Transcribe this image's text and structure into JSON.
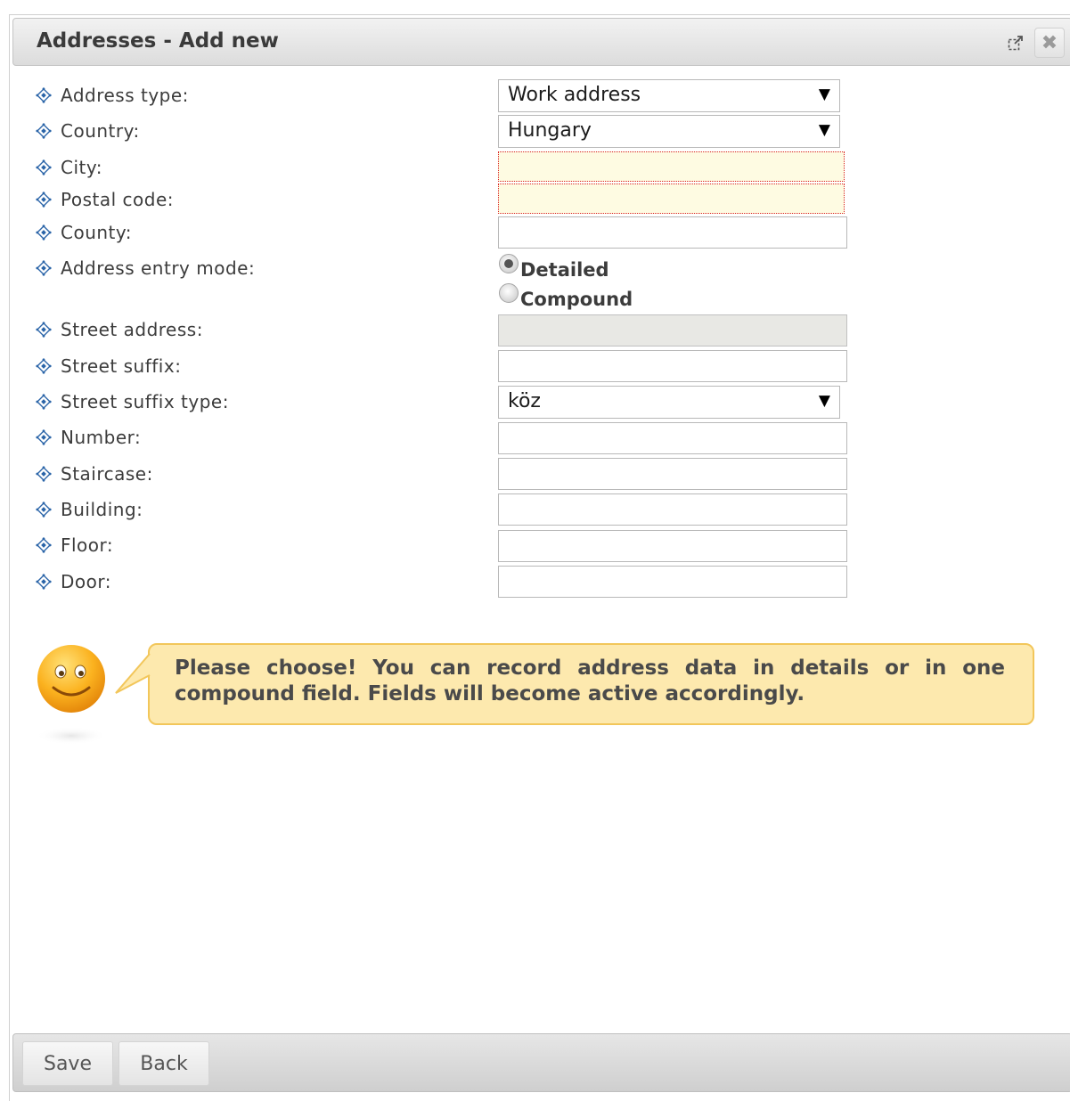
{
  "window": {
    "title": "Addresses - Add new",
    "popout_icon": "popout-icon",
    "close_icon": "close-icon"
  },
  "form": {
    "labels": {
      "address_type": "Address type:",
      "country": "Country:",
      "city": "City:",
      "postal_code": "Postal code:",
      "county": "County:",
      "entry_mode": "Address entry mode:",
      "street_address": "Street address:",
      "street_suffix": "Street suffix:",
      "street_suffix_type": "Street suffix type:",
      "number": "Number:",
      "staircase": "Staircase:",
      "building": "Building:",
      "floor": "Floor:",
      "door": "Door:"
    },
    "values": {
      "address_type": "Work address",
      "country": "Hungary",
      "city": "",
      "postal_code": "",
      "county": "",
      "street_address": "",
      "street_suffix": "",
      "street_suffix_type": "köz",
      "number": "",
      "staircase": "",
      "building": "",
      "floor": "",
      "door": ""
    },
    "entry_mode_options": [
      "Detailed",
      "Compound"
    ],
    "entry_mode_selected": "Detailed",
    "invalid_fields": [
      "city",
      "postal_code"
    ],
    "disabled_fields": [
      "street_address"
    ],
    "select_arrow": "▼"
  },
  "hint": {
    "text": "Please choose! You can record address data in details or in one compound field. Fields will become active accordingly.",
    "icon": "smiley-icon"
  },
  "footer": {
    "save_label": "Save",
    "back_label": "Back"
  },
  "colors": {
    "invalid_bg": "#fefbe2",
    "invalid_border": "#d92020",
    "hint_bg": "#fde9ae",
    "hint_border": "#f2c65a",
    "bullet": "#2a64a8"
  }
}
